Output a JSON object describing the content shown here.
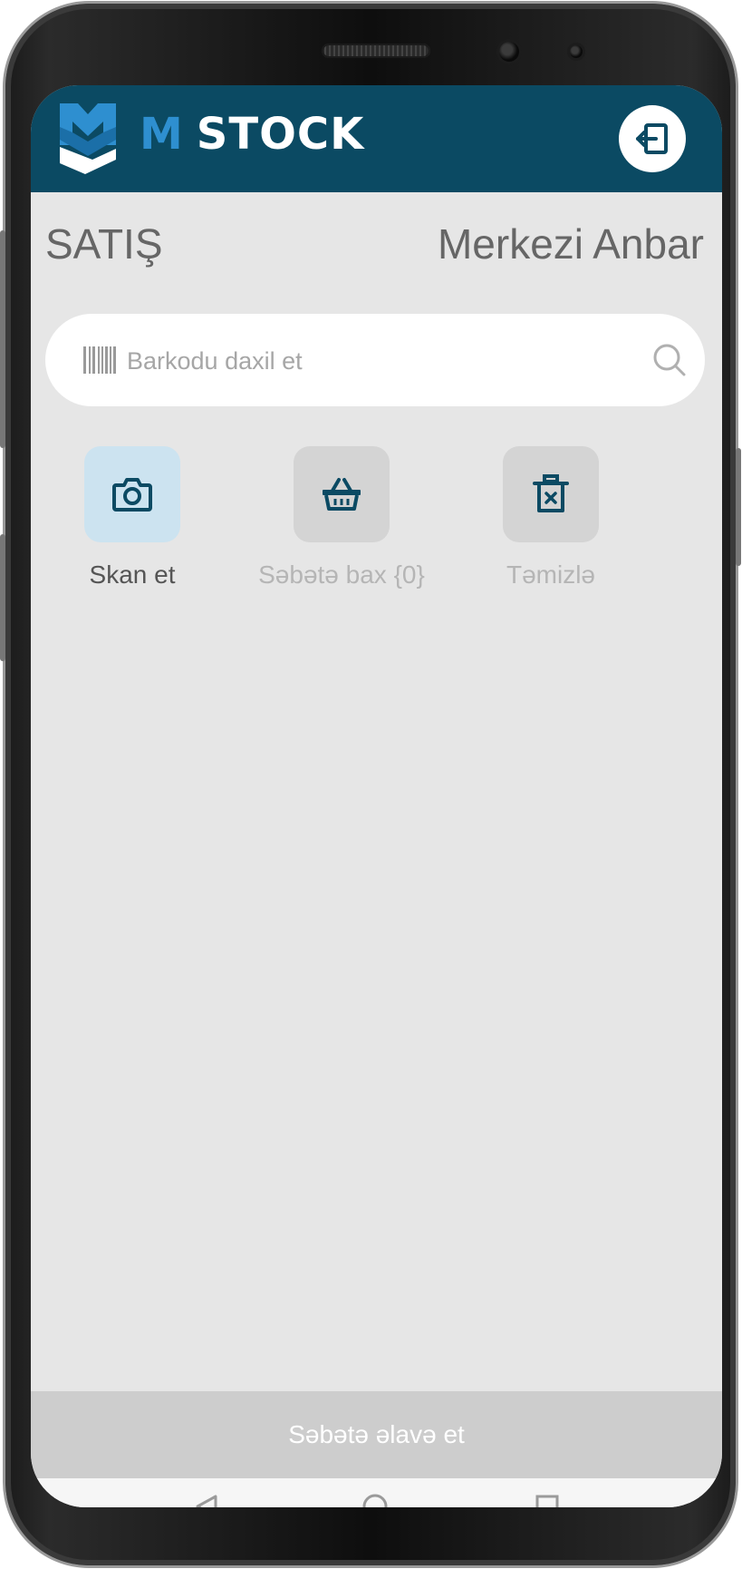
{
  "app": {
    "brand_initial": "M",
    "brand_name": "STOCK",
    "colors": {
      "header": "#0b4a63",
      "brand_accent": "#2e8fd0",
      "screen_background": "#e6e6e6",
      "scan_tile": "#cce3f0",
      "disabled_tile": "#d4d4d4",
      "primary_button_disabled": "#cdcdcd"
    }
  },
  "header": {
    "logout_icon": "logout-icon"
  },
  "page": {
    "title": "SATIŞ",
    "warehouse": "Merkezi Anbar"
  },
  "search": {
    "placeholder": "Barkodu daxil et",
    "value": "",
    "leading_icon": "barcode-icon",
    "trailing_icon": "search-icon"
  },
  "actions": [
    {
      "label": "Skan et",
      "icon": "camera-icon",
      "enabled": true
    },
    {
      "label": "Səbətə bax {0}",
      "icon": "basket-icon",
      "enabled": false
    },
    {
      "label": "Təmizlə",
      "icon": "trash-icon",
      "enabled": false
    }
  ],
  "footer": {
    "add_to_cart_label": "Səbətə əlavə et"
  },
  "system_nav": {
    "icons": [
      "back-icon",
      "home-icon",
      "recents-icon"
    ]
  }
}
